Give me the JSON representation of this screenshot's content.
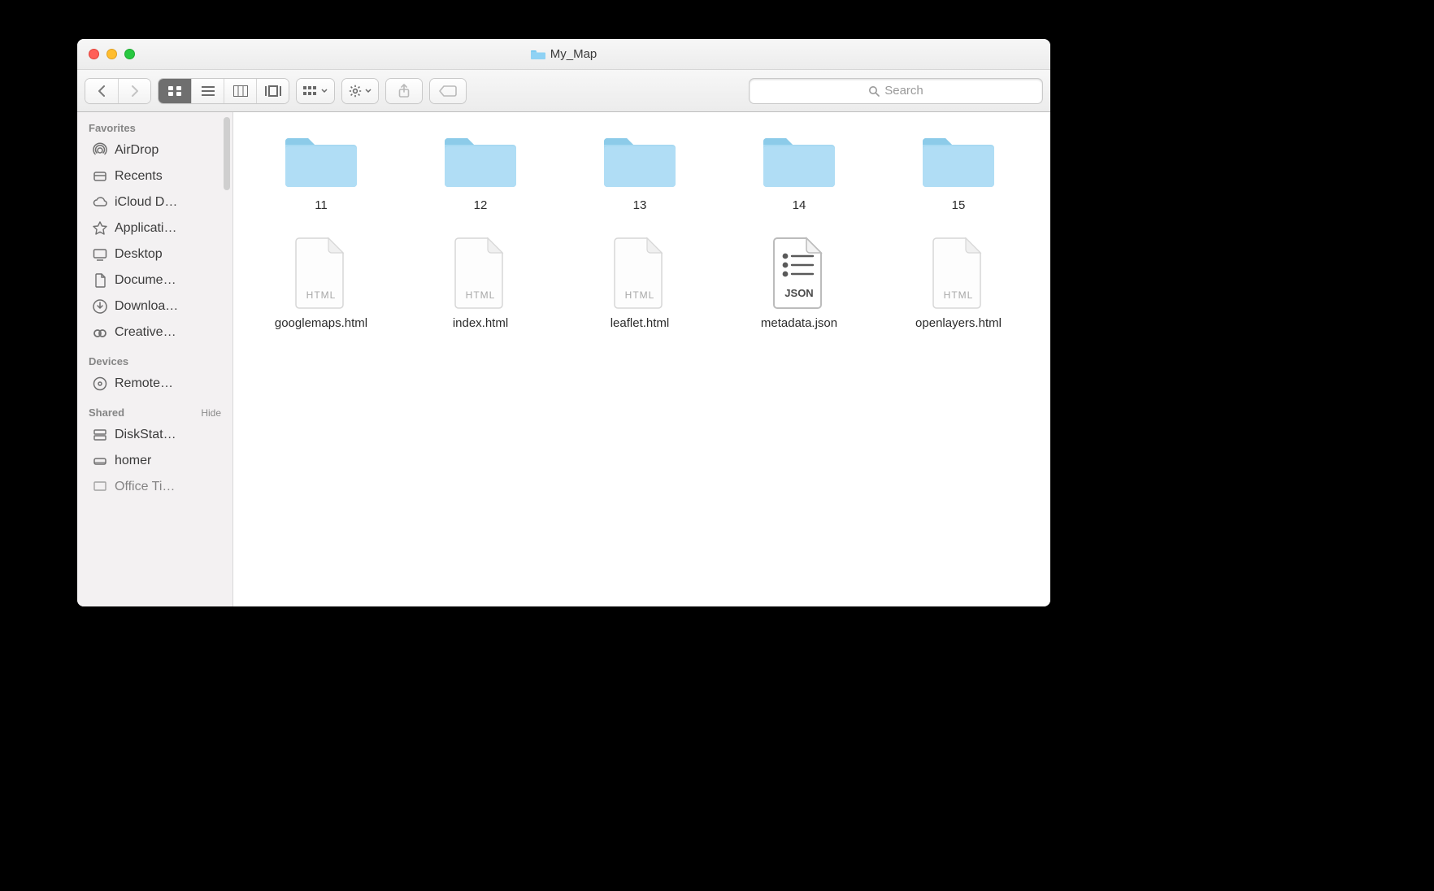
{
  "window": {
    "title": "My_Map"
  },
  "search": {
    "placeholder": "Search"
  },
  "sidebar": {
    "sections": {
      "favorites": {
        "label": "Favorites",
        "items": [
          {
            "label": "AirDrop"
          },
          {
            "label": "Recents"
          },
          {
            "label": "iCloud D…"
          },
          {
            "label": "Applicati…"
          },
          {
            "label": "Desktop"
          },
          {
            "label": "Docume…"
          },
          {
            "label": "Downloa…"
          },
          {
            "label": "Creative…"
          }
        ]
      },
      "devices": {
        "label": "Devices",
        "items": [
          {
            "label": "Remote…"
          }
        ]
      },
      "shared": {
        "label": "Shared",
        "hide_label": "Hide",
        "items": [
          {
            "label": "DiskStat…"
          },
          {
            "label": "homer"
          },
          {
            "label": "Office Ti…"
          }
        ]
      }
    }
  },
  "items": [
    {
      "name": "11",
      "kind": "folder"
    },
    {
      "name": "12",
      "kind": "folder"
    },
    {
      "name": "13",
      "kind": "folder"
    },
    {
      "name": "14",
      "kind": "folder"
    },
    {
      "name": "15",
      "kind": "folder"
    },
    {
      "name": "googlemaps.html",
      "kind": "html"
    },
    {
      "name": "index.html",
      "kind": "html"
    },
    {
      "name": "leaflet.html",
      "kind": "html"
    },
    {
      "name": "metadata.json",
      "kind": "json"
    },
    {
      "name": "openlayers.html",
      "kind": "html"
    }
  ],
  "file_badges": {
    "html": "HTML",
    "json": "JSON"
  }
}
